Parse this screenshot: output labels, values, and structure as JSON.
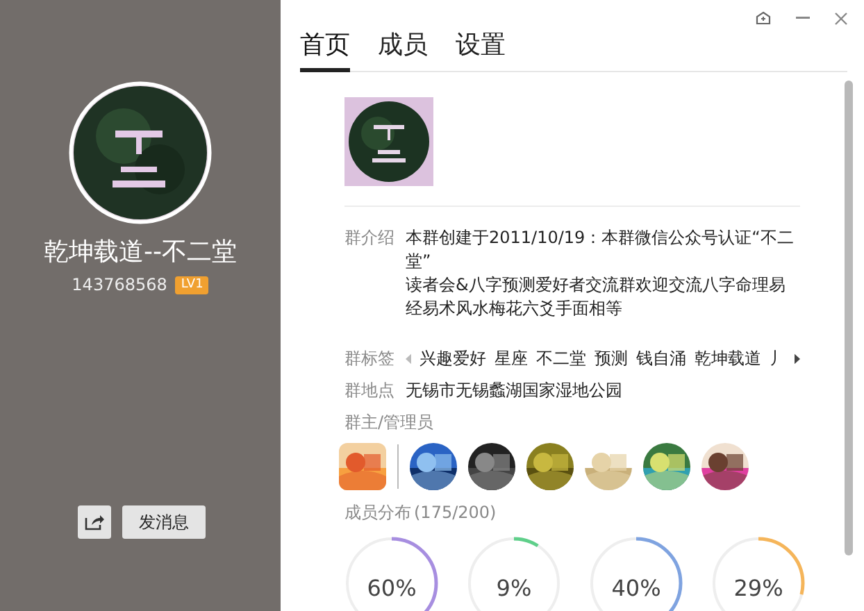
{
  "group": {
    "name": "乾坤载道--不二堂",
    "number": "143768568",
    "level_badge": "LV1"
  },
  "actions": {
    "send_message": "发消息"
  },
  "tabs": [
    {
      "label": "首页",
      "selected": true
    },
    {
      "label": "成员",
      "selected": false
    },
    {
      "label": "设置",
      "selected": false
    }
  ],
  "info": {
    "intro_label": "群介绍",
    "intro": "本群创建于2011/10/19：本群微信公众号认证“不二堂”\n读者会&八字预测爱好者交流群欢迎交流八字命理易经易术风水梅花六爻手面相等",
    "tags_label": "群标签",
    "tags": [
      "兴趣爱好",
      "星座",
      "不二堂",
      "预测",
      "钱自涌",
      "乾坤载道",
      "丿"
    ],
    "location_label": "群地点",
    "location": "无锡市无锡蠡湖国家湿地公园"
  },
  "admins_label": "群主/管理员",
  "distribution": {
    "label": "成员分布",
    "count": "(175/200)",
    "rings": [
      {
        "value": "60%",
        "color": "#a78ee0"
      },
      {
        "value": "9%",
        "color": "#5fcf8a"
      },
      {
        "value": "40%",
        "color": "#7fa3e0"
      },
      {
        "value": "29%",
        "color": "#f5b55a"
      }
    ]
  }
}
